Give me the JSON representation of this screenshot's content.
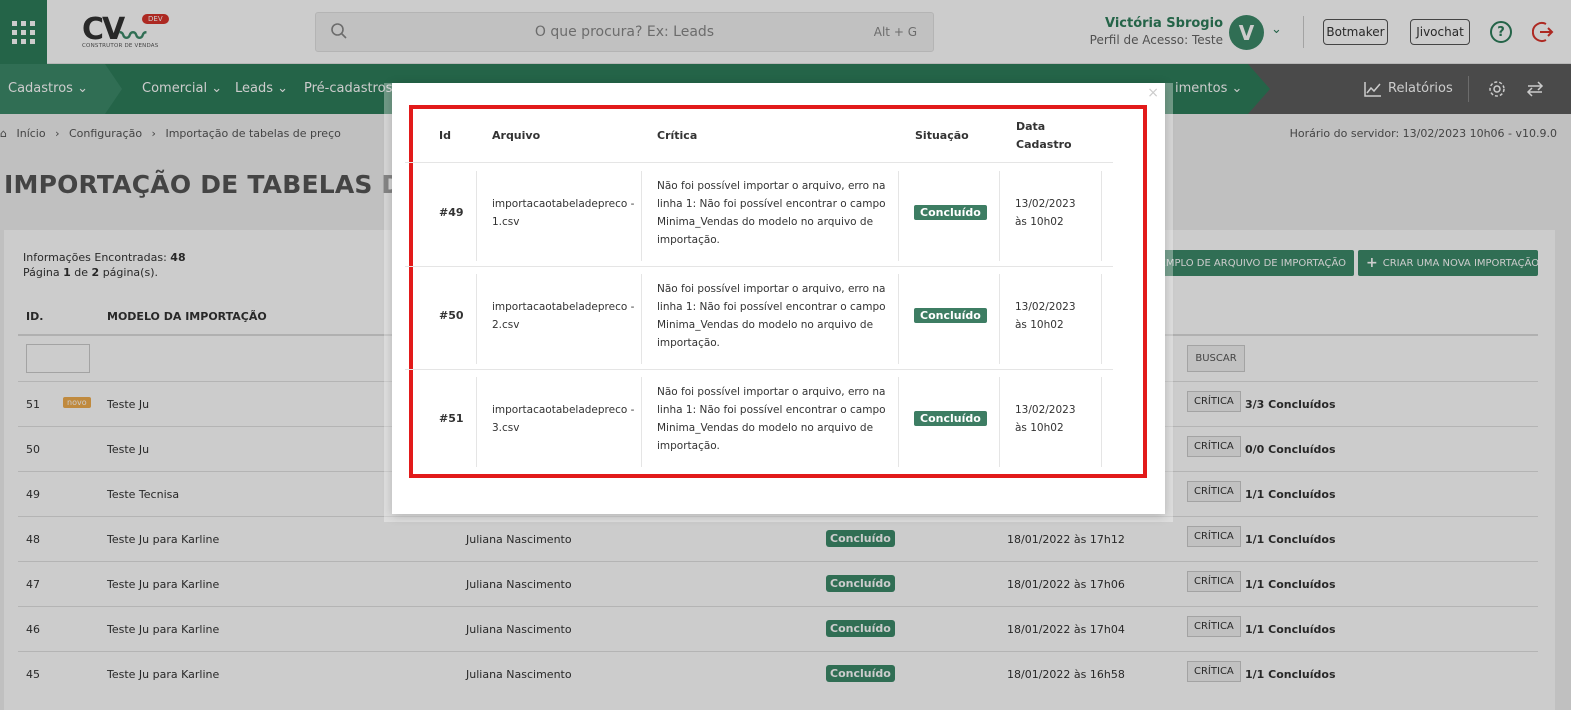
{
  "header": {
    "logo_text": "CV",
    "logo_badge": "DEV",
    "logo_sub": "CONSTRUTOR DE VENDAS",
    "search_placeholder": "O que procura? Ex: Leads",
    "search_shortcut": "Alt + G",
    "user_name": "Victória Sbrogio",
    "user_role": "Perfil de Acesso: Teste",
    "avatar_letter": "V",
    "botmaker_label": "Botmaker",
    "jivochat_label": "Jivochat",
    "help_label": "?"
  },
  "nav": {
    "items": [
      "Cadastros",
      "Comercial",
      "Leads",
      "Pré-cadastros",
      "imentos"
    ],
    "reports": "Relatórios"
  },
  "breadcrumb": [
    "Início",
    "Configuração",
    "Importação de tabelas de preço"
  ],
  "server_time": "Horário do servidor: 13/02/2023 10h06 - v10.9.0",
  "page_title": "IMPORTAÇÃO DE TABELAS DE P",
  "info": {
    "found_label": "Informações Encontradas:",
    "found_count": "48",
    "page_label_pre": "Página",
    "page_current": "1",
    "page_label_mid": "de",
    "page_total": "2",
    "page_label_post": "página(s)."
  },
  "buttons": {
    "example": "EXEMPLO DE ARQUIVO DE IMPORTAÇÃO",
    "create": "CRIAR UMA NOVA IMPORTAÇÃO",
    "search": "BUSCAR"
  },
  "table": {
    "col_id": "ID.",
    "col_model": "MODELO DA IMPORTAÇÃO",
    "new_badge": "novo",
    "critic_label": "CRÍTICA",
    "rows": [
      {
        "id": "51",
        "model": "Teste Ju",
        "user": "",
        "status": "",
        "date": "",
        "count": "3/3 Concluídos"
      },
      {
        "id": "50",
        "model": "Teste Ju",
        "user": "",
        "status": "",
        "date": "",
        "count": "0/0 Concluídos"
      },
      {
        "id": "49",
        "model": "Teste Tecnisa",
        "user": "",
        "status": "",
        "date": "",
        "count": "1/1 Concluídos"
      },
      {
        "id": "48",
        "model": "Teste Ju para Karline",
        "user": "Juliana Nascimento",
        "status": "Concluído",
        "date": "18/01/2022 às 17h12",
        "count": "1/1 Concluídos"
      },
      {
        "id": "47",
        "model": "Teste Ju para Karline",
        "user": "Juliana Nascimento",
        "status": "Concluído",
        "date": "18/01/2022 às 17h06",
        "count": "1/1 Concluídos"
      },
      {
        "id": "46",
        "model": "Teste Ju para Karline",
        "user": "Juliana Nascimento",
        "status": "Concluído",
        "date": "18/01/2022 às 17h04",
        "count": "1/1 Concluídos"
      },
      {
        "id": "45",
        "model": "Teste Ju para Karline",
        "user": "Juliana Nascimento",
        "status": "Concluído",
        "date": "18/01/2022 às 16h58",
        "count": "1/1 Concluídos"
      }
    ]
  },
  "modal": {
    "close": "×",
    "headers": {
      "id": "Id",
      "file": "Arquivo",
      "critic": "Crítica",
      "status": "Situação",
      "date_line1": "Data",
      "date_line2": "Cadastro"
    },
    "rows": [
      {
        "id": "#49",
        "file_l1": "importacaotabeladepreco -",
        "file_l2": "1.csv",
        "critic_l1": "Não foi possível importar o arquivo, erro na",
        "critic_l2": "linha 1: Não foi possível encontrar o campo",
        "critic_l3": "Minima_Vendas do modelo no arquivo de",
        "critic_l4": "importação.",
        "status": "Concluído",
        "date_l1": "13/02/2023",
        "date_l2": "às 10h02"
      },
      {
        "id": "#50",
        "file_l1": "importacaotabeladepreco -",
        "file_l2": "2.csv",
        "critic_l1": "Não foi possível importar o arquivo, erro na",
        "critic_l2": "linha 1: Não foi possível encontrar o campo",
        "critic_l3": "Minima_Vendas do modelo no arquivo de",
        "critic_l4": "importação.",
        "status": "Concluído",
        "date_l1": "13/02/2023",
        "date_l2": "às 10h02"
      },
      {
        "id": "#51",
        "file_l1": "importacaotabeladepreco -",
        "file_l2": "3.csv",
        "critic_l1": "Não foi possível importar o arquivo, erro na",
        "critic_l2": "linha 1: Não foi possível encontrar o campo",
        "critic_l3": "Minima_Vendas do modelo no arquivo de",
        "critic_l4": "importação.",
        "status": "Concluído",
        "date_l1": "13/02/2023",
        "date_l2": "às 10h02"
      }
    ]
  },
  "colors": {
    "brand_green": "#2e7d5b",
    "highlight_red": "#e21a1a",
    "badge_orange": "#f0ad4e"
  }
}
